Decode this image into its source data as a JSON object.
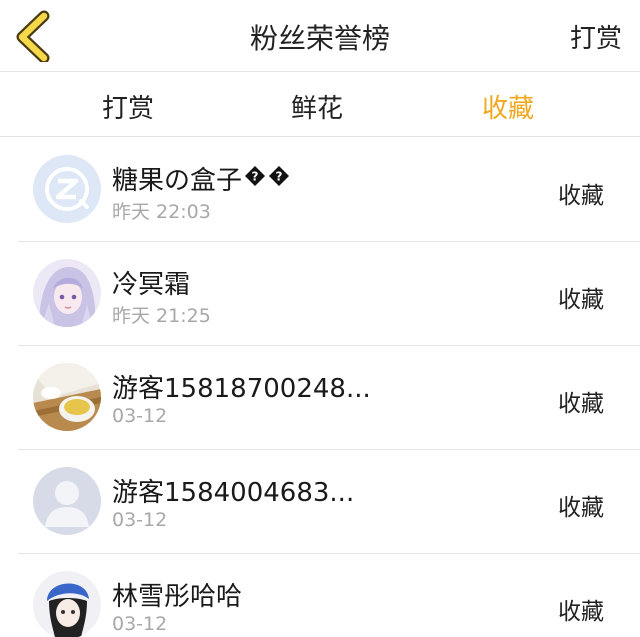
{
  "header": {
    "back_icon": "chevron-left-icon",
    "title": "粉丝荣誉榜",
    "right_label": "打赏"
  },
  "tabs": [
    {
      "label": "打赏",
      "active": false
    },
    {
      "label": "鲜花",
      "active": false
    },
    {
      "label": "收藏",
      "active": true
    }
  ],
  "colors": {
    "accent": "#f0a821",
    "back_chevron_fill": "#f5d94a",
    "back_chevron_stroke": "#4a3b12"
  },
  "list": [
    {
      "name": "糖果の盒子",
      "time": "昨天 22:03",
      "action": "收藏",
      "avatar": "default-qq-avatar"
    },
    {
      "name": "冷冥霜",
      "time": "昨天 21:25",
      "action": "收藏",
      "avatar": "anime-girl-avatar"
    },
    {
      "name": "游客15818700248...",
      "time": "03-12",
      "action": "收藏",
      "avatar": "tea-cup-avatar"
    },
    {
      "name": "游客1584004683...",
      "time": "03-12",
      "action": "收藏",
      "avatar": "default-person-avatar"
    },
    {
      "name": "林雪彤哈哈",
      "time": "03-12",
      "action": "收藏",
      "avatar": "anime-boy-avatar"
    }
  ]
}
